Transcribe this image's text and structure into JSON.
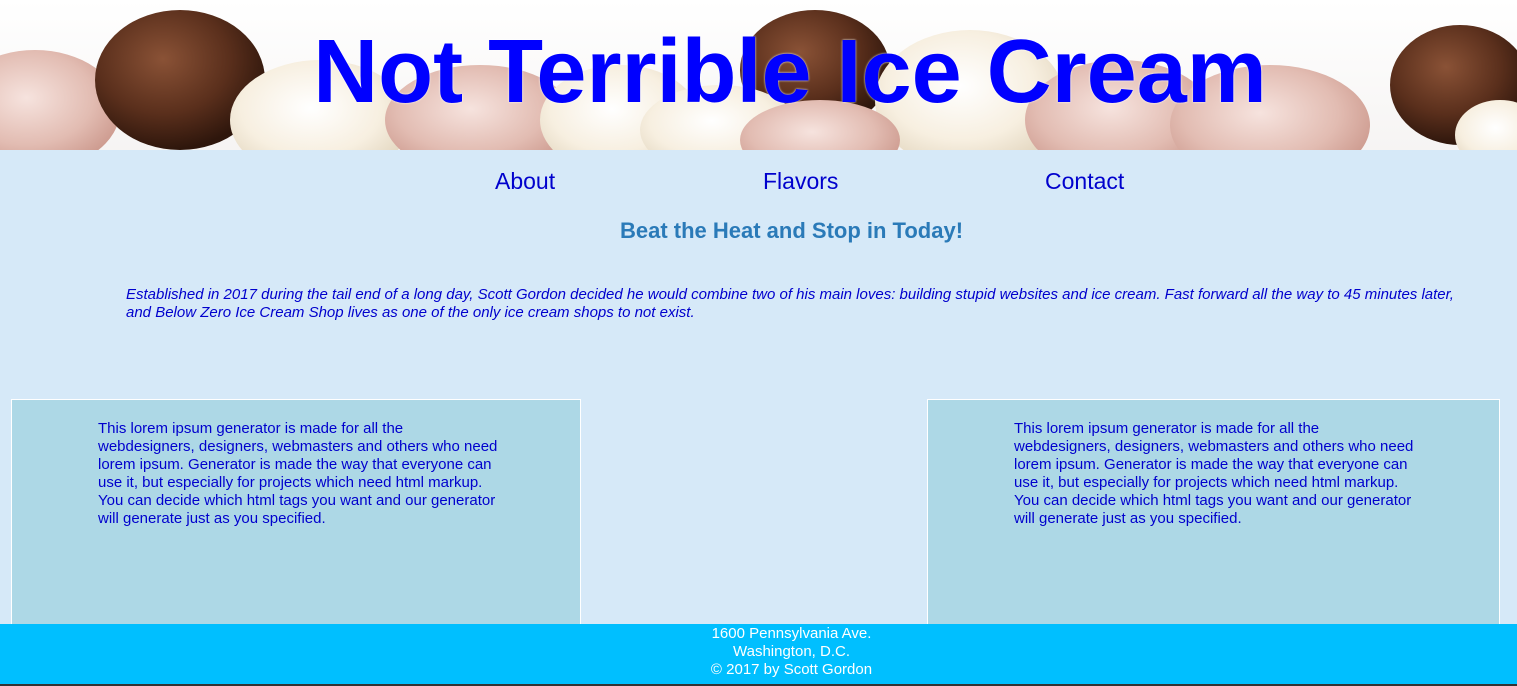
{
  "header": {
    "title": "Not Terrible Ice Cream"
  },
  "nav": {
    "about": "About",
    "flavors": "Flavors",
    "contact": "Contact"
  },
  "main": {
    "tagline": "Beat the Heat and Stop in Today!",
    "intro": "Established in 2017 during the tail end of a long day, Scott Gordon decided he would combine two of his main loves: building stupid websites and ice cream. Fast forward all the way to 45 minutes later, and Below Zero Ice Cream Shop lives as one of the only ice cream shops to not exist.",
    "cards": [
      {
        "text": "This lorem ipsum generator is made for all the webdesigners, designers, webmasters and others who need lorem ipsum. Generator is made the way that everyone can use it, but especially for projects which need html markup. You can decide which html tags you want and our generator will generate just as you specified."
      },
      {
        "text": "This lorem ipsum generator is made for all the webdesigners, designers, webmasters and others who need lorem ipsum. Generator is made the way that everyone can use it, but especially for projects which need html markup. You can decide which html tags you want and our generator will generate just as you specified."
      }
    ]
  },
  "footer": {
    "address": "1600 Pennsylvania Ave.",
    "city": "Washington, D.C.",
    "copyright": "© 2017 by Scott Gordon"
  },
  "colors": {
    "background": "#d6e9f8",
    "title": "#0000ff",
    "link": "#0000cd",
    "tagline": "#2a7ab8",
    "card": "#add8e6",
    "footer": "#00bfff"
  }
}
